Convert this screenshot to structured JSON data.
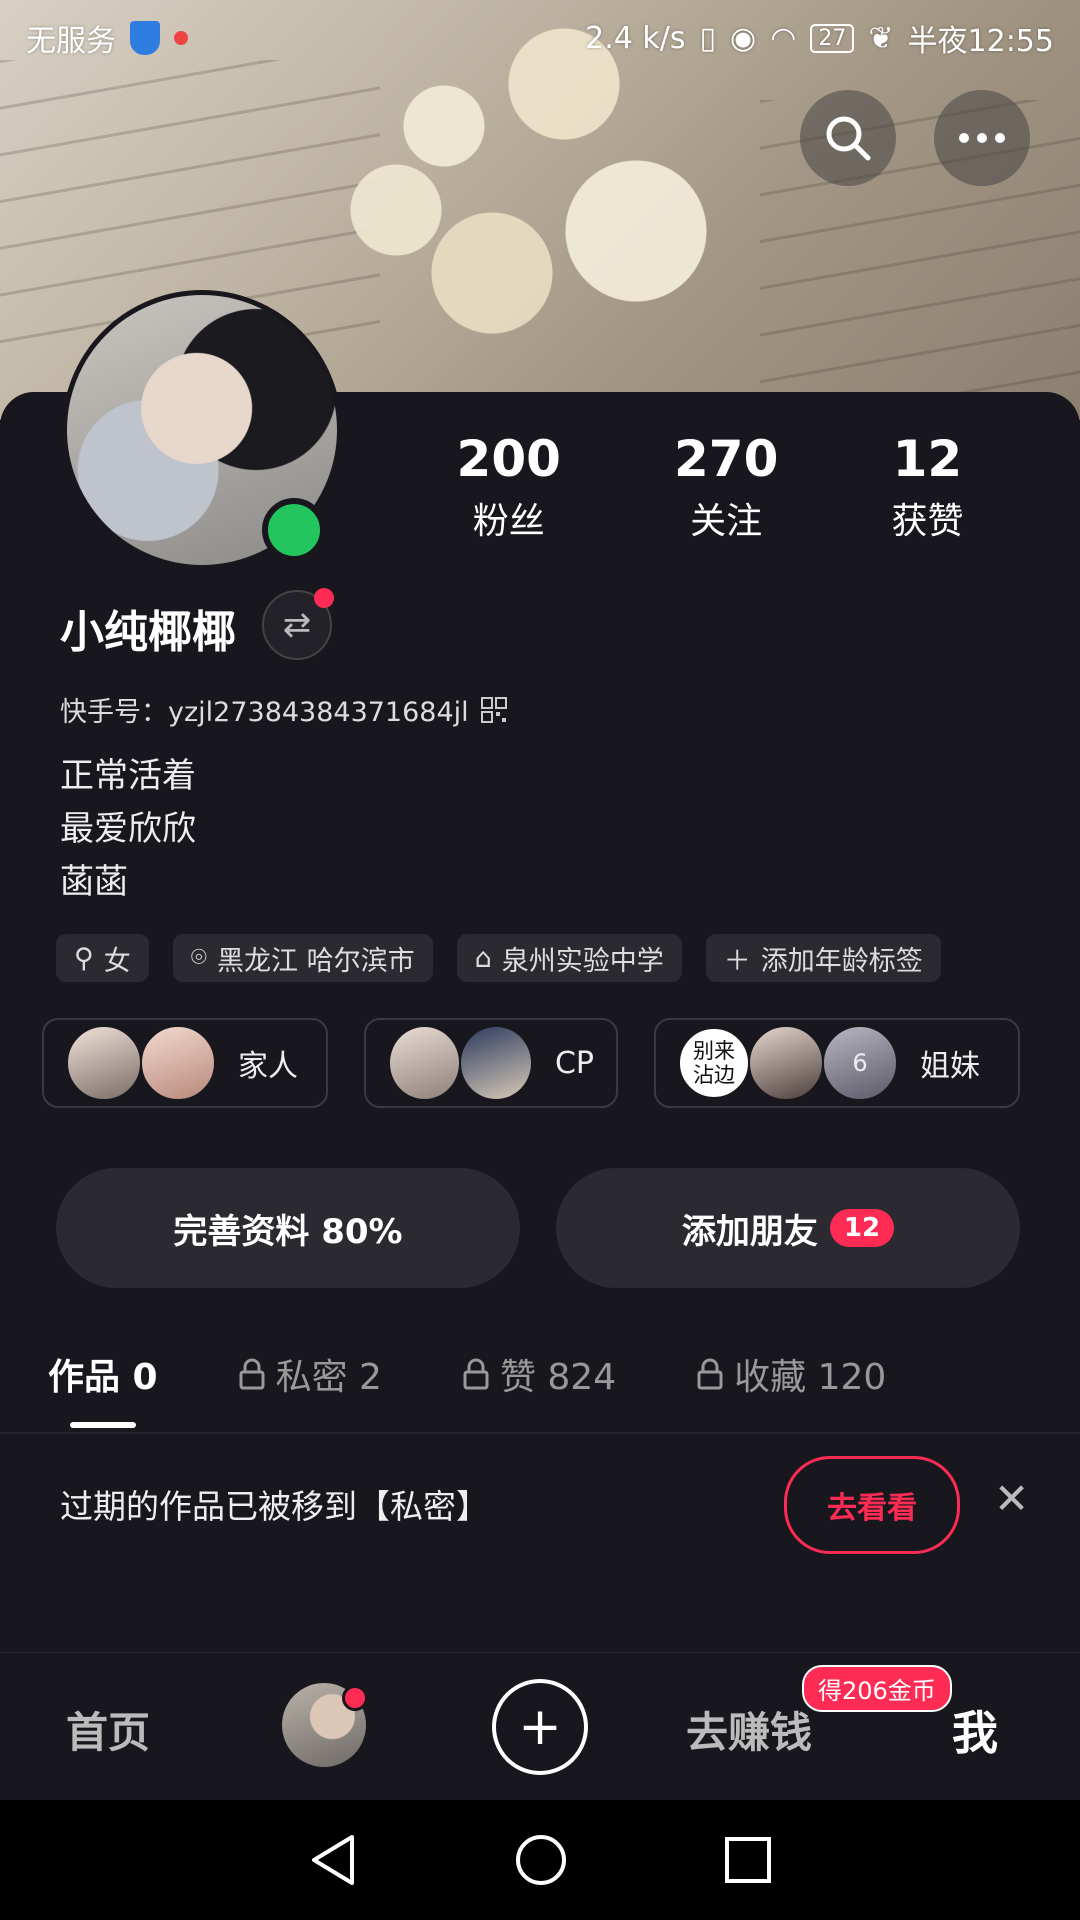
{
  "status_bar": {
    "carrier": "无服务",
    "speed": "2.4 k/s",
    "battery": "27",
    "time": "半夜12:55"
  },
  "profile": {
    "stats": [
      {
        "num": "200",
        "label": "粉丝"
      },
      {
        "num": "270",
        "label": "关注"
      },
      {
        "num": "12",
        "label": "获赞"
      }
    ],
    "name": "小纯椰椰",
    "kuaishou_id": "快手号：yzjl27384384371684jl",
    "bio": [
      "正常活着",
      "最爱欣欣",
      "菡菡"
    ],
    "tags": [
      {
        "icon": "gender-icon",
        "label": "女"
      },
      {
        "icon": "location-icon",
        "label": "黑龙江 哈尔滨市"
      },
      {
        "icon": "school-icon",
        "label": "泉州实验中学"
      },
      {
        "icon": "plus-icon",
        "label": "添加年龄标签"
      }
    ],
    "groups": [
      {
        "label": "家人"
      },
      {
        "label": "CP"
      },
      {
        "label": "姐妹",
        "extra_text": "别来沾边",
        "count": "6"
      }
    ],
    "actions": {
      "complete": "完善资料 80%",
      "add_friend": "添加朋友",
      "add_friend_count": "12"
    }
  },
  "tabs": [
    {
      "label": "作品 0",
      "locked": false
    },
    {
      "label": "私密 2",
      "locked": true
    },
    {
      "label": "赞 824",
      "locked": true
    },
    {
      "label": "收藏 120",
      "locked": true
    }
  ],
  "notice": {
    "text": "过期的作品已被移到【私密】",
    "button": "去看看"
  },
  "bottom_nav": {
    "home": "首页",
    "earn": "去赚钱",
    "earn_badge": "得206金币",
    "me": "我"
  },
  "colors": {
    "accent": "#fe2c55",
    "online": "#22c55e",
    "background": "#17171d"
  }
}
